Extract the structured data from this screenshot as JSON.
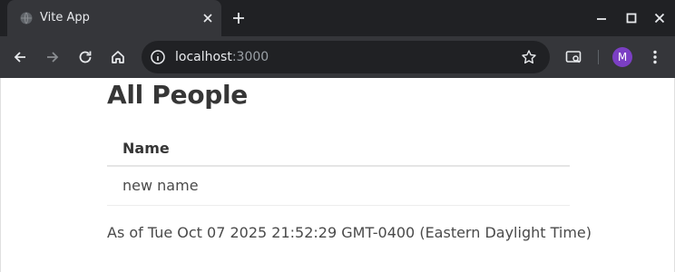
{
  "browser": {
    "tab_title": "Vite App",
    "url_host": "localhost",
    "url_port": ":3000",
    "profile_initial": "M"
  },
  "page": {
    "title": "All People",
    "table": {
      "columns": [
        "Name"
      ],
      "rows": [
        [
          "new name"
        ]
      ]
    },
    "as_of": "As of Tue Oct 07 2025 21:52:29 GMT-0400 (Eastern Daylight Time)"
  },
  "colors": {
    "tabbar_bg": "#202124",
    "toolbar_bg": "#35363a",
    "avatar_bg": "#7b3fc4"
  }
}
